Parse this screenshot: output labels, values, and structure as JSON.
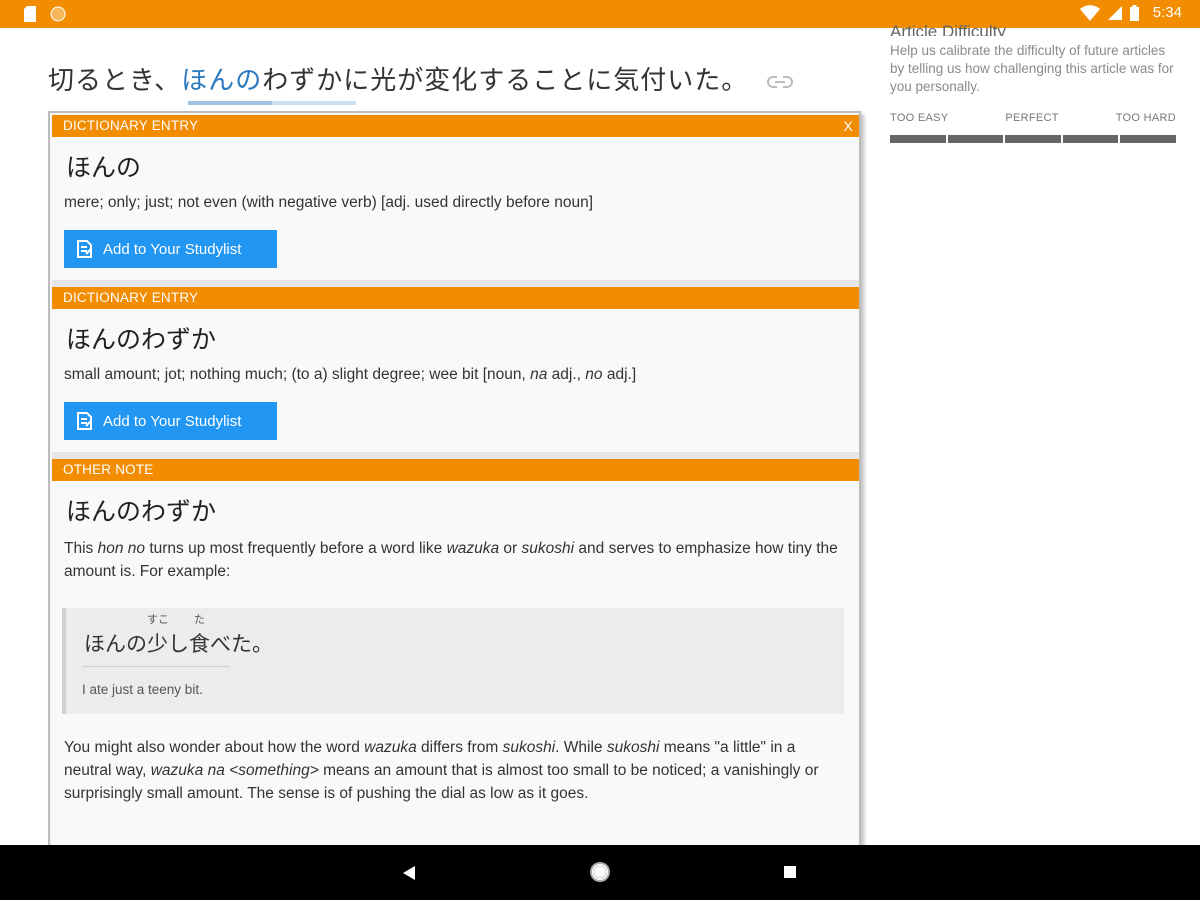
{
  "status_bar": {
    "time": "5:34"
  },
  "article": {
    "sentence_before": "切るとき、",
    "sentence_highlight": "ほんの",
    "sentence_after": "わずかに光が変化することに気付いた。"
  },
  "difficulty": {
    "title": "Article Difficulty",
    "description": "Help us calibrate the difficulty of future articles by telling us how challenging this article was for you personally.",
    "labels": {
      "easy": "TOO EASY",
      "perfect": "PERFECT",
      "hard": "TOO HARD"
    },
    "segments": 5
  },
  "popup": {
    "close_label": "X",
    "entries": [
      {
        "header": "DICTIONARY ENTRY",
        "word": "ほんの",
        "definition": "mere; only; just; not even (with negative verb) [adj. used directly before noun]",
        "button_label": "Add to Your Studylist"
      },
      {
        "header": "DICTIONARY ENTRY",
        "word": "ほんのわずか",
        "definition_parts": [
          "small amount; jot; nothing much; (to a) slight degree; wee bit [noun, ",
          "na",
          " adj., ",
          "no",
          " adj.]"
        ],
        "button_label": "Add to Your Studylist"
      }
    ],
    "note": {
      "header": "OTHER NOTE",
      "word": "ほんのわずか",
      "para1_parts": [
        "This ",
        "hon no",
        " turns up most frequently before a word like ",
        "wazuka",
        " or ",
        "sukoshi",
        " and serves to emphasize how tiny the amount is. For example:"
      ],
      "example": {
        "jp_before": "ほんの",
        "kanji1": "少",
        "kanji1_reading": "すこ",
        "mid": "し",
        "kanji2": "食",
        "kanji2_reading": "た",
        "jp_after": "べた。",
        "translation": "I ate just a teeny bit."
      },
      "para2_parts": [
        "You might also wonder about how the word ",
        "wazuka",
        " differs from ",
        "sukoshi",
        ". While ",
        "sukoshi",
        " means \"a little\" in a neutral way, ",
        "wazuka na <something>",
        " means an amount that is almost too small to be noticed; a vanishingly or surprisingly small amount. The sense is of pushing the dial as low as it goes."
      ]
    }
  },
  "colors": {
    "accent_orange": "#f28c00",
    "button_blue": "#2196f3",
    "highlight_blue": "#2a78bd"
  }
}
